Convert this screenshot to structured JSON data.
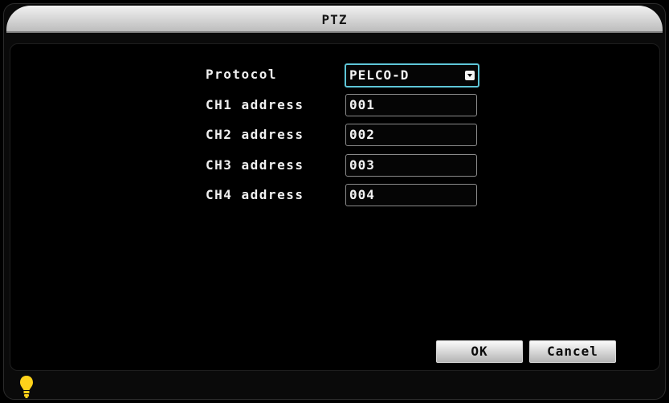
{
  "window": {
    "title": "PTZ"
  },
  "form": {
    "protocol": {
      "label": "Protocol",
      "value": "PELCO-D"
    },
    "addresses": [
      {
        "label": "CH1 address",
        "value": "001"
      },
      {
        "label": "CH2 address",
        "value": "002"
      },
      {
        "label": "CH3 address",
        "value": "003"
      },
      {
        "label": "CH4 address",
        "value": "004"
      }
    ]
  },
  "buttons": {
    "ok": "OK",
    "cancel": "Cancel"
  },
  "status": {
    "icon": "lightbulb-icon",
    "icon_color": "#ffd21a"
  },
  "colors": {
    "focus_border": "#5ec6d8",
    "title_bar": "#d8d8d8",
    "background": "#000000"
  }
}
